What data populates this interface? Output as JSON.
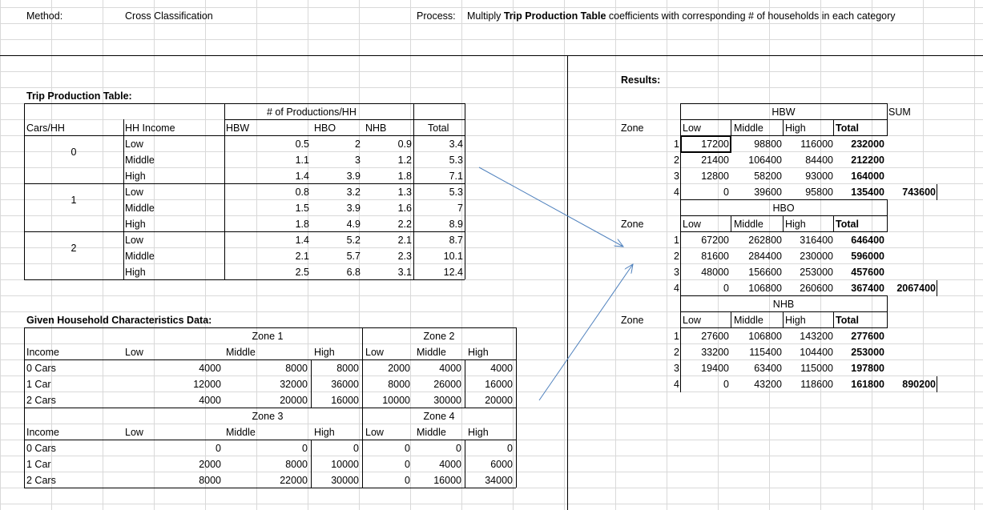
{
  "header": {
    "method_label": "Method:",
    "method_value": "Cross Classification",
    "process_label": "Process:",
    "process_pre": "Multiply ",
    "process_bold": "Trip Production Table",
    "process_post": " coefficients with corresponding # of households in each category"
  },
  "trip_table": {
    "title": "Trip Production Table:",
    "group_header": "# of Productions/HH",
    "headers": [
      "Cars/HH",
      "HH Income",
      "HBW",
      "HBO",
      "NHB",
      "Total"
    ],
    "rows": [
      {
        "cars": "0",
        "income": "Low",
        "hbw": "0.5",
        "hbo": "2",
        "nhb": "0.9",
        "total": "3.4"
      },
      {
        "cars": "",
        "income": "Middle",
        "hbw": "1.1",
        "hbo": "3",
        "nhb": "1.2",
        "total": "5.3"
      },
      {
        "cars": "",
        "income": "High",
        "hbw": "1.4",
        "hbo": "3.9",
        "nhb": "1.8",
        "total": "7.1"
      },
      {
        "cars": "1",
        "income": "Low",
        "hbw": "0.8",
        "hbo": "3.2",
        "nhb": "1.3",
        "total": "5.3"
      },
      {
        "cars": "",
        "income": "Middle",
        "hbw": "1.5",
        "hbo": "3.9",
        "nhb": "1.6",
        "total": "7"
      },
      {
        "cars": "",
        "income": "High",
        "hbw": "1.8",
        "hbo": "4.9",
        "nhb": "2.2",
        "total": "8.9"
      },
      {
        "cars": "2",
        "income": "Low",
        "hbw": "1.4",
        "hbo": "5.2",
        "nhb": "2.1",
        "total": "8.7"
      },
      {
        "cars": "",
        "income": "Middle",
        "hbw": "2.1",
        "hbo": "5.7",
        "nhb": "2.3",
        "total": "10.1"
      },
      {
        "cars": "",
        "income": "High",
        "hbw": "2.5",
        "hbo": "6.8",
        "nhb": "3.1",
        "total": "12.4"
      }
    ]
  },
  "household": {
    "title": "Given Household Characteristics Data:",
    "blocks": [
      {
        "zones": [
          "Zone 1",
          "Zone 2"
        ],
        "cols": [
          "Income",
          "Low",
          "Middle",
          "High",
          "Low",
          "Middle",
          "High"
        ],
        "rows": [
          [
            "0 Cars",
            "4000",
            "8000",
            "8000",
            "2000",
            "4000",
            "4000"
          ],
          [
            "1 Car",
            "12000",
            "32000",
            "36000",
            "8000",
            "26000",
            "16000"
          ],
          [
            "2 Cars",
            "4000",
            "20000",
            "16000",
            "10000",
            "30000",
            "20000"
          ]
        ]
      },
      {
        "zones": [
          "Zone 3",
          "Zone 4"
        ],
        "cols": [
          "Income",
          "Low",
          "Middle",
          "High",
          "Low",
          "Middle",
          "High"
        ],
        "rows": [
          [
            "0 Cars",
            "0",
            "0",
            "0",
            "0",
            "0",
            "0"
          ],
          [
            "1 Car",
            "2000",
            "8000",
            "10000",
            "0",
            "4000",
            "6000"
          ],
          [
            "2 Cars",
            "8000",
            "22000",
            "30000",
            "0",
            "16000",
            "34000"
          ]
        ]
      }
    ]
  },
  "results": {
    "title": "Results:",
    "sum_label": "SUM",
    "sections": [
      {
        "name": "HBW",
        "zone_label": "Zone",
        "cols": [
          "Low",
          "Middle",
          "High",
          "Total"
        ],
        "rows": [
          [
            "1",
            "17200",
            "98800",
            "116000",
            "232000"
          ],
          [
            "2",
            "21400",
            "106400",
            "84400",
            "212200"
          ],
          [
            "3",
            "12800",
            "58200",
            "93000",
            "164000"
          ],
          [
            "4",
            "0",
            "39600",
            "95800",
            "135400"
          ]
        ],
        "sum": "743600"
      },
      {
        "name": "HBO",
        "zone_label": "Zone",
        "cols": [
          "Low",
          "Middle",
          "High",
          "Total"
        ],
        "rows": [
          [
            "1",
            "67200",
            "262800",
            "316400",
            "646400"
          ],
          [
            "2",
            "81600",
            "284400",
            "230000",
            "596000"
          ],
          [
            "3",
            "48000",
            "156600",
            "253000",
            "457600"
          ],
          [
            "4",
            "0",
            "106800",
            "260600",
            "367400"
          ]
        ],
        "sum": "2067400"
      },
      {
        "name": "NHB",
        "zone_label": "Zone",
        "cols": [
          "Low",
          "Middle",
          "High",
          "Total"
        ],
        "rows": [
          [
            "1",
            "27600",
            "106800",
            "143200",
            "277600"
          ],
          [
            "2",
            "33200",
            "115400",
            "104400",
            "253000"
          ],
          [
            "3",
            "19400",
            "63400",
            "115000",
            "197800"
          ],
          [
            "4",
            "0",
            "43200",
            "118600",
            "161800"
          ]
        ],
        "sum": "890200"
      }
    ]
  },
  "colors": {
    "arrow": "#4f81bd",
    "gridline": "#d9d9d9"
  }
}
